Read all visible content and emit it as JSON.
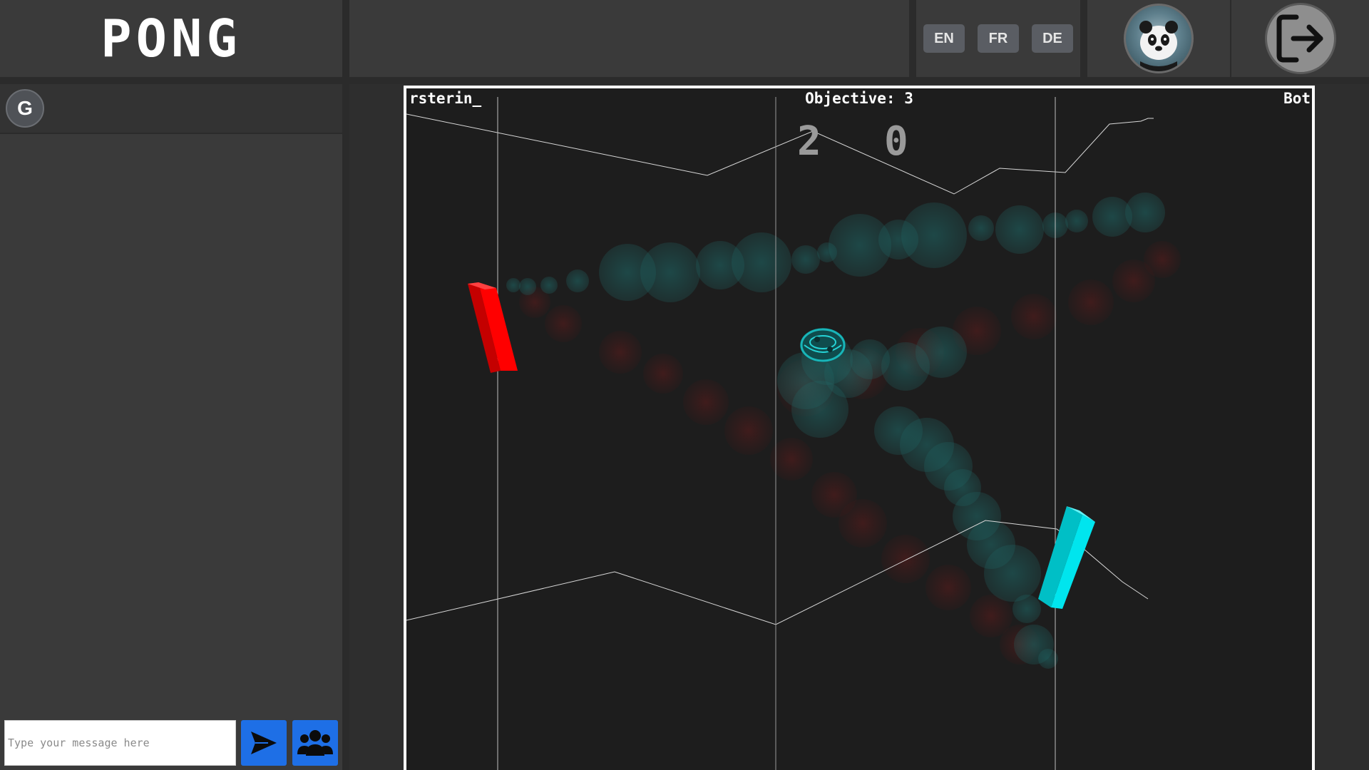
{
  "header": {
    "logo": "PONG",
    "languages": [
      "EN",
      "FR",
      "DE"
    ],
    "avatar_icon": "panda-avatar-icon",
    "logout_icon": "logout-icon"
  },
  "sidebar": {
    "channel_avatar_letter": "G",
    "message_placeholder": "Type your message here",
    "send_icon": "send-icon",
    "friends_icon": "friends-icon"
  },
  "game": {
    "player_left": "rsterin_",
    "player_right": "Bot",
    "objective": "Objective: 3",
    "score_left": "2",
    "score_right": "0",
    "colors": {
      "left_paddle": "#ff0000",
      "right_paddle": "#00e5ee",
      "ball": "#19b5b8",
      "lines": "#d8d8d8"
    }
  }
}
